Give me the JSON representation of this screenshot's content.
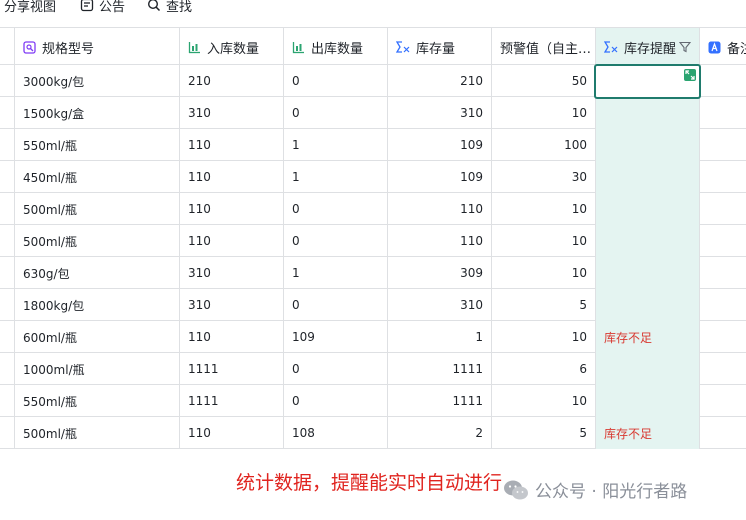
{
  "toolbar": {
    "items": [
      {
        "label": "分享视图",
        "icon": "share-icon"
      },
      {
        "label": "公告",
        "icon": "announcement-icon"
      },
      {
        "label": "查找",
        "icon": "search-icon"
      }
    ]
  },
  "columns": [
    {
      "label": "规格型号",
      "icon": "text-field-icon"
    },
    {
      "label": "入库数量",
      "icon": "bar-chart-icon"
    },
    {
      "label": "出库数量",
      "icon": "bar-chart-icon"
    },
    {
      "label": "库存量",
      "icon": "formula-icon"
    },
    {
      "label": "预警值（自主…",
      "icon": ""
    },
    {
      "label": "库存提醒",
      "icon": "formula-icon",
      "filter_icon": "filter-icon"
    },
    {
      "label": "备注",
      "icon": "ai-field-icon"
    }
  ],
  "rows": [
    {
      "spec": "3000kg/包",
      "in": "210",
      "out": "0",
      "stock": "210",
      "warn": "50",
      "alert": ""
    },
    {
      "spec": "1500kg/盒",
      "in": "310",
      "out": "0",
      "stock": "310",
      "warn": "10",
      "alert": ""
    },
    {
      "spec": "550ml/瓶",
      "in": "110",
      "out": "1",
      "stock": "109",
      "warn": "100",
      "alert": ""
    },
    {
      "spec": "450ml/瓶",
      "in": "110",
      "out": "1",
      "stock": "109",
      "warn": "30",
      "alert": ""
    },
    {
      "spec": "500ml/瓶",
      "in": "110",
      "out": "0",
      "stock": "110",
      "warn": "10",
      "alert": ""
    },
    {
      "spec": "500ml/瓶",
      "in": "110",
      "out": "0",
      "stock": "110",
      "warn": "10",
      "alert": ""
    },
    {
      "spec": "630g/包",
      "in": "310",
      "out": "1",
      "stock": "309",
      "warn": "10",
      "alert": ""
    },
    {
      "spec": "1800kg/包",
      "in": "310",
      "out": "0",
      "stock": "310",
      "warn": "5",
      "alert": ""
    },
    {
      "spec": "600ml/瓶",
      "in": "110",
      "out": "109",
      "stock": "1",
      "warn": "10",
      "alert": "库存不足"
    },
    {
      "spec": "1000ml/瓶",
      "in": "1111",
      "out": "0",
      "stock": "1111",
      "warn": "6",
      "alert": ""
    },
    {
      "spec": "550ml/瓶",
      "in": "1111",
      "out": "0",
      "stock": "1111",
      "warn": "10",
      "alert": ""
    },
    {
      "spec": "500ml/瓶",
      "in": "110",
      "out": "108",
      "stock": "2",
      "warn": "5",
      "alert": "库存不足"
    }
  ],
  "caption": "统计数据，提醒能实时自动进行",
  "watermark": "公众号 · 阳光行者路",
  "colors": {
    "alert": "#d83931",
    "selection": "#1f7b6d",
    "highlight_column": "#e4f4f1",
    "caption": "#e0241f"
  }
}
